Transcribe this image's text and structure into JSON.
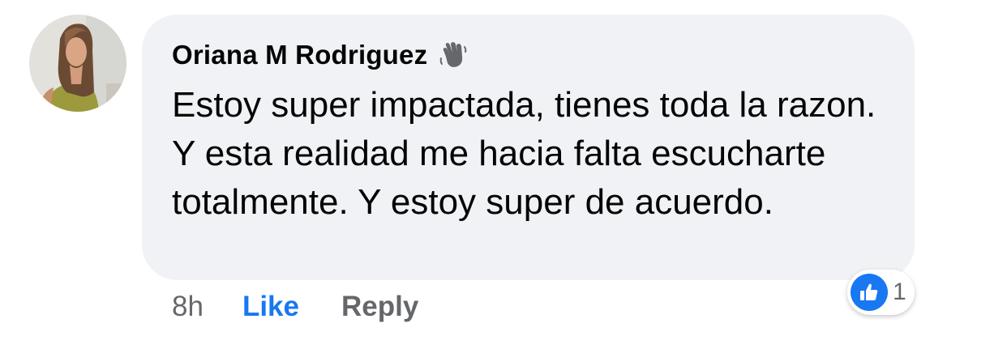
{
  "comment": {
    "author": "Oriana M Rodriguez",
    "badge_icon": "waving-hand-icon",
    "text": "Estoy super impactada, tienes toda la razon. Y esta realidad me hacia falta escucharte totalmente. Y estoy super de acuerdo.",
    "timestamp": "8h",
    "like_label": "Like",
    "reply_label": "Reply",
    "reaction": {
      "icon": "thumbs-up-icon",
      "count": "1"
    }
  },
  "colors": {
    "bubble": "#f0f2f5",
    "accent": "#1877f2",
    "secondary_text": "#65676b",
    "primary_text": "#050505"
  }
}
